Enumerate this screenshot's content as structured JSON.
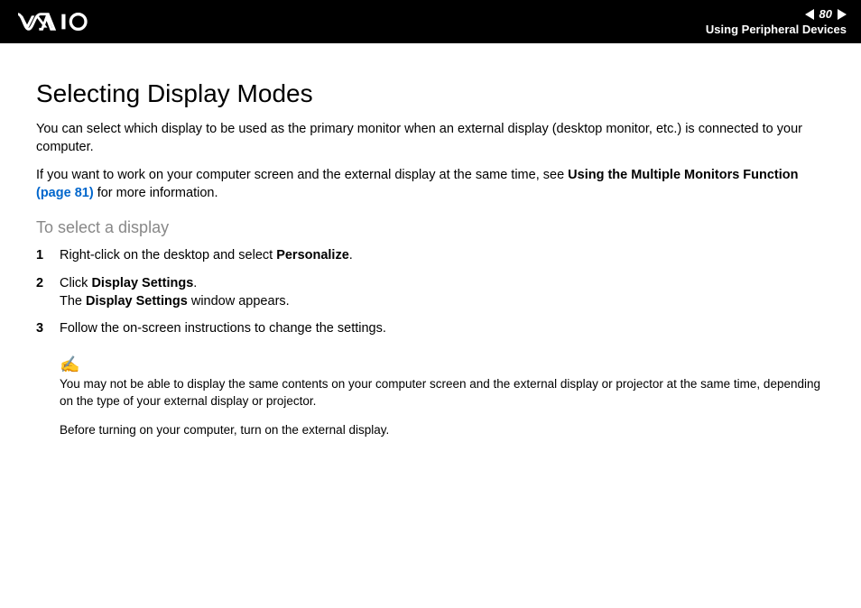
{
  "header": {
    "page_number": "80",
    "section": "Using Peripheral Devices"
  },
  "content": {
    "title": "Selecting Display Modes",
    "para1": "You can select which display to be used as the primary monitor when an external display (desktop monitor, etc.) is connected to your computer.",
    "para2_a": "If you want to work on your computer screen and the external display at the same time, see ",
    "para2_bold": "Using the Multiple Monitors Function ",
    "para2_link": "(page 81)",
    "para2_b": " for more information.",
    "subtitle": "To select a display",
    "steps": {
      "s1_a": "Right-click on the desktop and select ",
      "s1_b": "Personalize",
      "s1_c": ".",
      "s2_a": "Click ",
      "s2_b": "Display Settings",
      "s2_c": ".",
      "s2_d": "The ",
      "s2_e": "Display Settings",
      "s2_f": " window appears.",
      "s3": "Follow the on-screen instructions to change the settings."
    },
    "note_icon": "✍",
    "note1": "You may not be able to display the same contents on your computer screen and the external display or projector at the same time, depending on the type of your external display or projector.",
    "note2": "Before turning on your computer, turn on the external display."
  }
}
